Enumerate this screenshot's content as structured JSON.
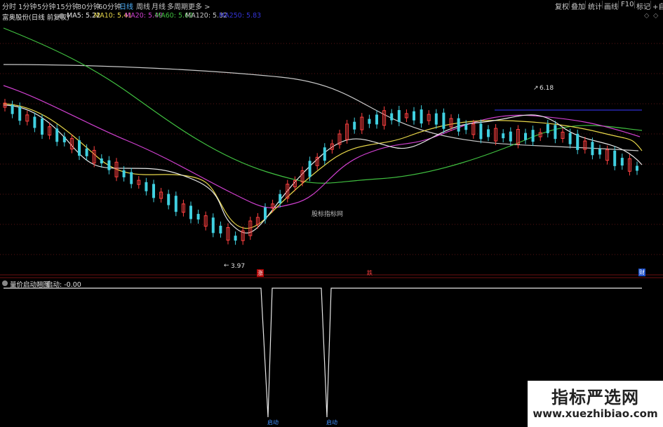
{
  "toolbar": {
    "periods": [
      "分时",
      "1分钟",
      "5分钟",
      "15分钟",
      "30分钟",
      "60分钟",
      "日线",
      "周线",
      "月线",
      "多周期",
      "更多 >"
    ],
    "active_period": "日线",
    "right_buttons": [
      "复权",
      "叠加",
      "统计",
      "画线",
      "F10",
      "标记",
      "+自"
    ]
  },
  "main_legend": {
    "stock_name": "富奥股份(日线 前复权)",
    "ma": [
      {
        "label": "MA5: 5.22",
        "color": "#e8e8e8"
      },
      {
        "label": "MA10: 5.41",
        "color": "#e8d84a"
      },
      {
        "label": "MA20: 5.49",
        "color": "#d040d0"
      },
      {
        "label": "MA60: 5.62",
        "color": "#40c040"
      },
      {
        "label": "MA120: 5.32",
        "color": "#c8c8c8"
      },
      {
        "label": "MA250: 5.83",
        "color": "#2f2fd0"
      }
    ]
  },
  "annotations": {
    "high_label": "6.18",
    "low_label": "3.97",
    "center_watermark": "股标指标网",
    "marker_rise": "涨",
    "marker_fall": "跌",
    "marker_right": "财"
  },
  "sub_legend": {
    "indicator_name": "量价启动翘图",
    "value_label": "启动: -0.00",
    "signal_labels": [
      "启动",
      "启动"
    ]
  },
  "watermark": {
    "title": "指标严选网",
    "url": "www.xuezhibiao.com"
  },
  "colors": {
    "up_candle": "#ff4040",
    "down_candle": "#40d0e0",
    "background": "#000000",
    "active_tab": "#4fb3ff"
  },
  "chart_data": {
    "type": "candlestick",
    "price_high": 6.18,
    "price_low": 3.97,
    "moving_averages": [
      "MA5",
      "MA10",
      "MA20",
      "MA60",
      "MA120",
      "MA250"
    ],
    "sub_indicator_signals": 2
  }
}
